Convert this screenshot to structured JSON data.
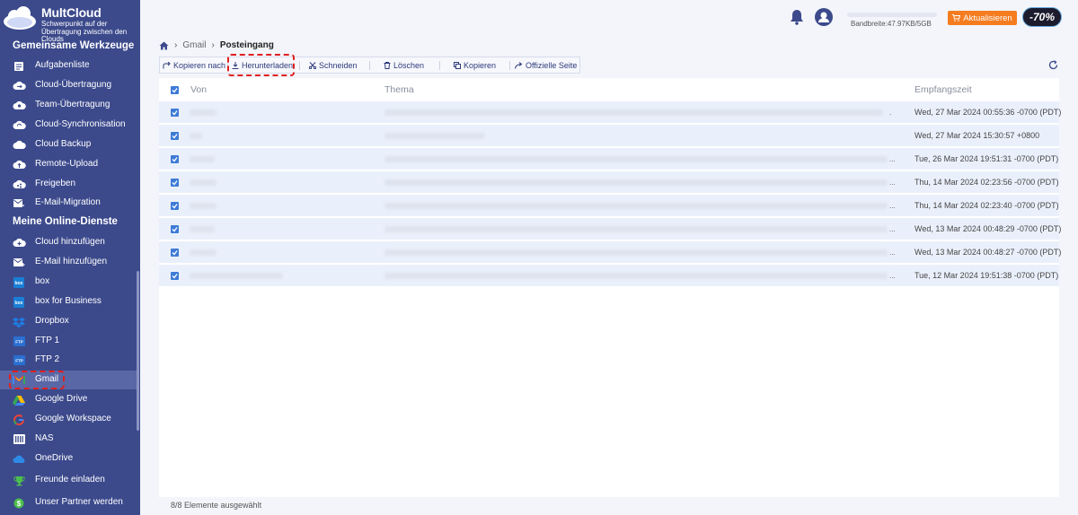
{
  "app": {
    "name": "MultCloud",
    "tagline": "Schwerpunkt auf der Übertragung zwischen den Clouds"
  },
  "sidebar": {
    "section_tools": "Gemeinsame Werkzeuge",
    "tools": [
      {
        "label": "Aufgabenliste",
        "icon": "list-icon"
      },
      {
        "label": "Cloud-Übertragung",
        "icon": "cloud-transfer-icon"
      },
      {
        "label": "Team-Übertragung",
        "icon": "team-transfer-icon"
      },
      {
        "label": "Cloud-Synchronisation",
        "icon": "cloud-sync-icon"
      },
      {
        "label": "Cloud Backup",
        "icon": "cloud-backup-icon"
      },
      {
        "label": "Remote-Upload",
        "icon": "remote-upload-icon"
      },
      {
        "label": "Freigeben",
        "icon": "share-icon"
      },
      {
        "label": "E-Mail-Migration",
        "icon": "email-migration-icon"
      }
    ],
    "section_services": "Meine Online-Dienste",
    "services": [
      {
        "label": "Cloud hinzufügen",
        "icon": "add-cloud-icon"
      },
      {
        "label": "E-Mail hinzufügen",
        "icon": "add-email-icon"
      },
      {
        "label": "box",
        "icon": "box-icon"
      },
      {
        "label": "box for Business",
        "icon": "box-business-icon"
      },
      {
        "label": "Dropbox",
        "icon": "dropbox-icon"
      },
      {
        "label": "FTP 1",
        "icon": "ftp-icon"
      },
      {
        "label": "FTP 2",
        "icon": "ftp-icon"
      },
      {
        "label": "Gmail",
        "icon": "gmail-icon",
        "active": true
      },
      {
        "label": "Google Drive",
        "icon": "google-drive-icon"
      },
      {
        "label": "Google Workspace",
        "icon": "google-workspace-icon"
      },
      {
        "label": "NAS",
        "icon": "nas-icon"
      },
      {
        "label": "OneDrive",
        "icon": "onedrive-icon"
      }
    ],
    "invite": "Freunde einladen",
    "partner": "Unser Partner werden"
  },
  "header": {
    "bandwidth": "Bandbreite:47.97KB/5GB",
    "upgrade_label": "Aktualisieren",
    "promo": "-70%"
  },
  "breadcrumb": {
    "parent": "Gmail",
    "current": "Posteingang"
  },
  "toolbar": {
    "copy_to": "Kopieren nach",
    "download": "Herunterladen",
    "cut": "Schneiden",
    "delete": "Löschen",
    "copy": "Kopieren",
    "official": "Offizielle Seite"
  },
  "table": {
    "columns": {
      "from": "Von",
      "subject": "Thema",
      "received": "Empfangszeit"
    },
    "rows": [
      {
        "received": "Wed, 27 Mar 2024 00:55:36 -0700 (PDT)",
        "checked": true
      },
      {
        "received": "Wed, 27 Mar 2024 15:30:57 +0800",
        "checked": true
      },
      {
        "received": "Tue, 26 Mar 2024 19:51:31 -0700 (PDT)",
        "checked": true
      },
      {
        "received": "Thu, 14 Mar 2024 02:23:56 -0700 (PDT)",
        "checked": true
      },
      {
        "received": "Thu, 14 Mar 2024 02:23:40 -0700 (PDT)",
        "checked": true
      },
      {
        "received": "Wed, 13 Mar 2024 00:48:29 -0700 (PDT)",
        "checked": true
      },
      {
        "received": "Wed, 13 Mar 2024 00:48:27 -0700 (PDT)",
        "checked": true
      },
      {
        "received": "Tue, 12 Mar 2024 19:51:38 -0700 (PDT)",
        "checked": true
      }
    ]
  },
  "status": "8/8 Elemente ausgewählt",
  "colors": {
    "sidebar_bg": "#3c4a8c",
    "accent": "#3e7bd6",
    "upgrade": "#f57c1f",
    "highlight": "#e02020"
  }
}
